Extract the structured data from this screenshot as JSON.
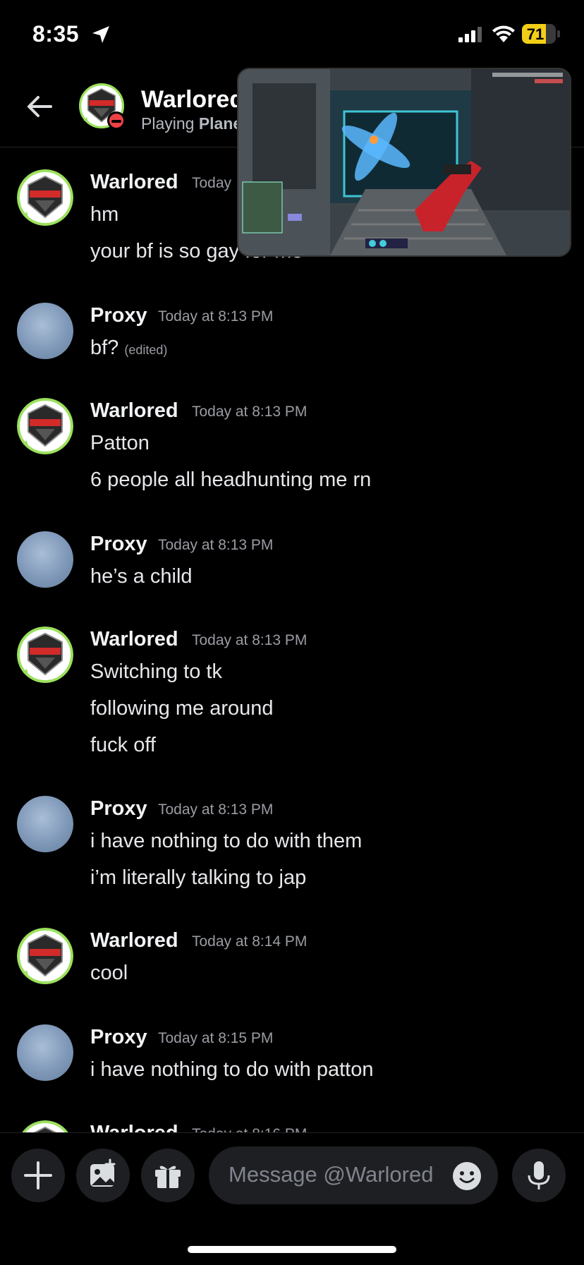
{
  "status_bar": {
    "time": "8:35",
    "battery": "71",
    "battery_level": 0.71
  },
  "header": {
    "name": "Warlored",
    "status_prefix": "Playing",
    "status_game": "Plane"
  },
  "composer": {
    "placeholder": "Message @Warlored"
  },
  "messages": [
    {
      "author": "Warlored",
      "time": "Today",
      "lines": [
        "hm",
        "your bf is so gay for me"
      ]
    },
    {
      "author": "Proxy",
      "time": "Today at 8:13 PM",
      "lines": [
        "bf?"
      ],
      "edited": "(edited)"
    },
    {
      "author": "Warlored",
      "time": "Today at 8:13 PM",
      "lines": [
        "Patton",
        "6 people all headhunting me rn"
      ]
    },
    {
      "author": "Proxy",
      "time": "Today at 8:13 PM",
      "lines": [
        "he’s a child"
      ]
    },
    {
      "author": "Warlored",
      "time": "Today at 8:13 PM",
      "lines": [
        "Switching to tk",
        "following me around",
        "fuck off"
      ]
    },
    {
      "author": "Proxy",
      "time": "Today at 8:13 PM",
      "lines": [
        "i have nothing to do with them",
        "i’m literally talking to jap"
      ]
    },
    {
      "author": "Warlored",
      "time": "Today at 8:14 PM",
      "lines": [
        "cool"
      ]
    },
    {
      "author": "Proxy",
      "time": "Today at 8:15 PM",
      "lines": [
        "i have nothing to do with patton"
      ]
    },
    {
      "author": "Warlored",
      "time": "Today at 8:16 PM",
      "lines": []
    }
  ]
}
